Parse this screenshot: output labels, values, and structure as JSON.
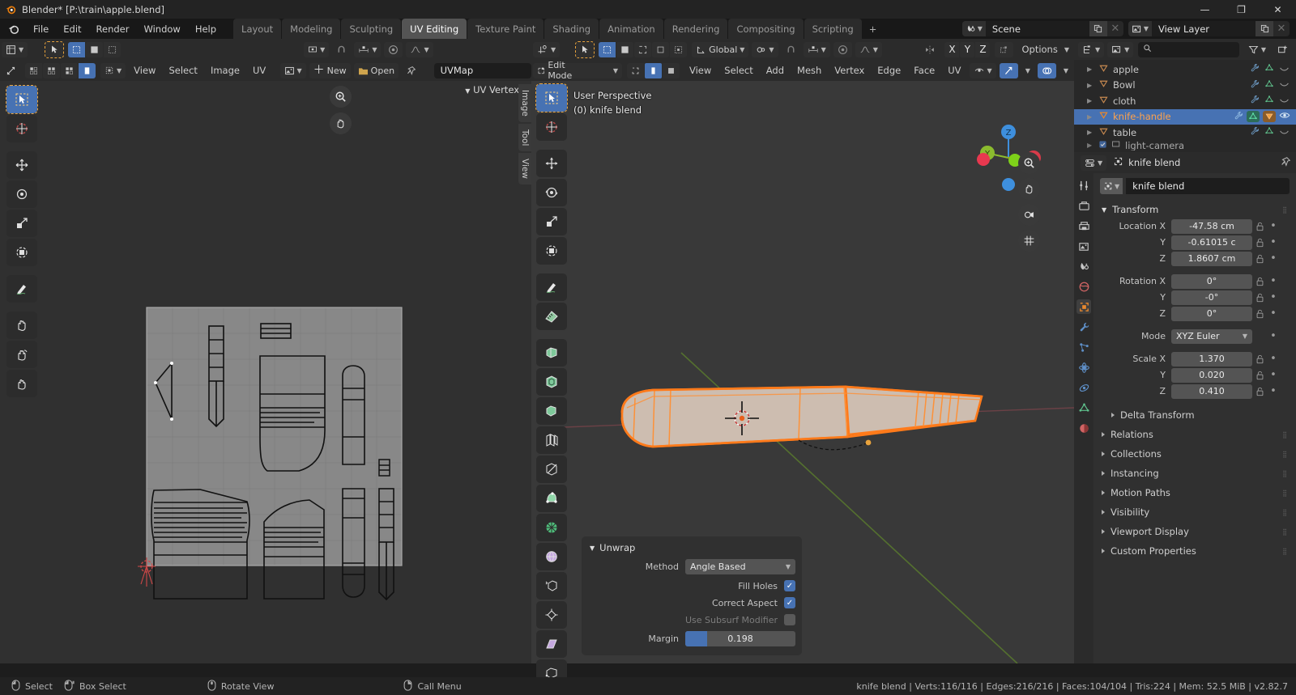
{
  "window": {
    "title": "Blender* [P:\\train\\apple.blend]",
    "minimize": "—",
    "maximize": "❐",
    "close": "✕"
  },
  "topbar": {
    "menus": [
      "File",
      "Edit",
      "Render",
      "Window",
      "Help"
    ],
    "workspaces": [
      {
        "label": "Layout",
        "active": false
      },
      {
        "label": "Modeling",
        "active": false
      },
      {
        "label": "Sculpting",
        "active": false
      },
      {
        "label": "UV Editing",
        "active": true
      },
      {
        "label": "Texture Paint",
        "active": false
      },
      {
        "label": "Shading",
        "active": false
      },
      {
        "label": "Animation",
        "active": false
      },
      {
        "label": "Rendering",
        "active": false
      },
      {
        "label": "Compositing",
        "active": false
      },
      {
        "label": "Scripting",
        "active": false
      }
    ],
    "add_workspace": "+",
    "scene": {
      "name": "Scene",
      "new_icon": "duplicate-icon",
      "remove_icon": "x-icon"
    },
    "view_layer": {
      "name": "View Layer",
      "new_icon": "duplicate-icon",
      "remove_icon": "x-icon"
    }
  },
  "uv_editor": {
    "editor_type_icon": "uv-editor-icon",
    "mode_label": "UV Vertex",
    "menus": [
      "View",
      "Select",
      "Image",
      "UV"
    ],
    "new_button": "New",
    "open_button": "Open",
    "pin_icon": "pin-icon",
    "uvmap_name": "UVMap",
    "sticky_icon": "sticky-selection-icon",
    "side_tabs": [
      "Image",
      "Tool",
      "View"
    ],
    "tools": [
      "tweak-tool",
      "cursor-tool",
      "move-tool",
      "rotate-tool",
      "scale-tool",
      "transform-tool",
      "annotate-tool",
      "grab-tool",
      "relax-tool",
      "pinch-tool"
    ],
    "zoom_icon": "zoom-icon",
    "pan_icon": "hand-icon"
  },
  "viewport": {
    "mode": "Edit Mode",
    "menus": [
      "View",
      "Select",
      "Add",
      "Mesh",
      "Vertex",
      "Edge",
      "Face",
      "UV"
    ],
    "transform_orientation": "Global",
    "options_label": "Options",
    "axis_labels": [
      "X",
      "Y",
      "Z"
    ],
    "overlay_text_line1": "User Perspective",
    "overlay_text_line2": "(0) knife blend",
    "gizmo_axes": [
      {
        "label": "Z",
        "color": "#3e8fdd"
      },
      {
        "label": "Y",
        "color": "#8bbb2e"
      },
      {
        "label": "X",
        "color": "#d93b4a"
      }
    ],
    "nav_buttons": [
      "zoom-icon",
      "hand-icon",
      "camera-icon",
      "grid-icon"
    ],
    "tools": [
      "tweak-tool",
      "cursor-tool",
      "move-tool",
      "rotate-tool",
      "scale-tool",
      "transform-tool",
      "annotate-tool",
      "measure-tool",
      "extrude-region-tool",
      "inset-faces-tool",
      "bevel-tool",
      "loop-cut-tool",
      "knife-tool",
      "poly-build-tool",
      "spin-tool",
      "smooth-tool",
      "edge-slide-tool",
      "shrink-fatten-tool",
      "shear-tool",
      "rip-region-tool"
    ],
    "operator_panel": {
      "title": "Unwrap",
      "method_label": "Method",
      "method_value": "Angle Based",
      "fill_holes_label": "Fill Holes",
      "fill_holes_checked": true,
      "correct_aspect_label": "Correct Aspect",
      "correct_aspect_checked": true,
      "use_subsurf_label": "Use Subsurf Modifier",
      "use_subsurf_checked": false,
      "margin_label": "Margin",
      "margin_value": "0.198"
    }
  },
  "outliner": {
    "display_mode_icon": "outliner-icon",
    "filter_icon": "filter-icon",
    "new_collection_icon": "new-collection-icon",
    "search_placeholder": "",
    "search_icon": "search-icon",
    "items": [
      {
        "name": "apple",
        "selected": false
      },
      {
        "name": "Bowl",
        "selected": false
      },
      {
        "name": "cloth",
        "selected": false
      },
      {
        "name": "knife-handle",
        "selected": true
      },
      {
        "name": "table",
        "selected": false
      },
      {
        "name": "light-camera",
        "selected": false
      }
    ]
  },
  "properties": {
    "editor_icon": "properties-icon",
    "breadcrumb_icon": "object-icon",
    "breadcrumb": "knife blend",
    "pin_icon": "pin-icon",
    "object_name": "knife blend",
    "tabs": [
      "tool-tab",
      "render-tab",
      "output-tab",
      "view-layer-tab",
      "scene-tab",
      "world-tab",
      "object-tab",
      "modifiers-tab",
      "particles-tab",
      "physics-tab",
      "constraints-tab",
      "data-tab",
      "material-tab"
    ],
    "transform": {
      "title": "Transform",
      "location": {
        "label_x": "Location X",
        "label_y": "Y",
        "label_z": "Z",
        "x": "-47.58 cm",
        "y": "-0.61015 c",
        "z": "1.8607 cm"
      },
      "rotation": {
        "label_x": "Rotation X",
        "label_y": "Y",
        "label_z": "Z",
        "x": "0°",
        "y": "-0°",
        "z": "0°"
      },
      "mode": {
        "label": "Mode",
        "value": "XYZ Euler"
      },
      "scale": {
        "label_x": "Scale X",
        "label_y": "Y",
        "label_z": "Z",
        "x": "1.370",
        "y": "0.020",
        "z": "0.410"
      }
    },
    "sub_panels": [
      "Delta Transform"
    ],
    "collapsed_panels": [
      "Relations",
      "Collections",
      "Instancing",
      "Motion Paths",
      "Visibility",
      "Viewport Display",
      "Custom Properties"
    ]
  },
  "status_bar": {
    "hints": [
      {
        "icon": "mouse-left-icon",
        "label": "Select"
      },
      {
        "icon": "mouse-left-drag-icon",
        "label": "Box Select"
      },
      {
        "icon": "mouse-middle-icon",
        "label": "Rotate View"
      },
      {
        "icon": "mouse-right-icon",
        "label": "Call Menu"
      }
    ],
    "stats": "knife blend | Verts:116/116 | Edges:216/216 | Faces:104/104 | Tris:224 | Mem: 52.5 MiB | v2.82.7"
  },
  "colors": {
    "accent_blue": "#4772b3",
    "accent_orange": "#ffa24b",
    "selection_edge": "#ff7a1a",
    "bg_dark": "#1d1d1d",
    "header_bg": "#2b2b2b",
    "viewport_bg": "#393939"
  }
}
